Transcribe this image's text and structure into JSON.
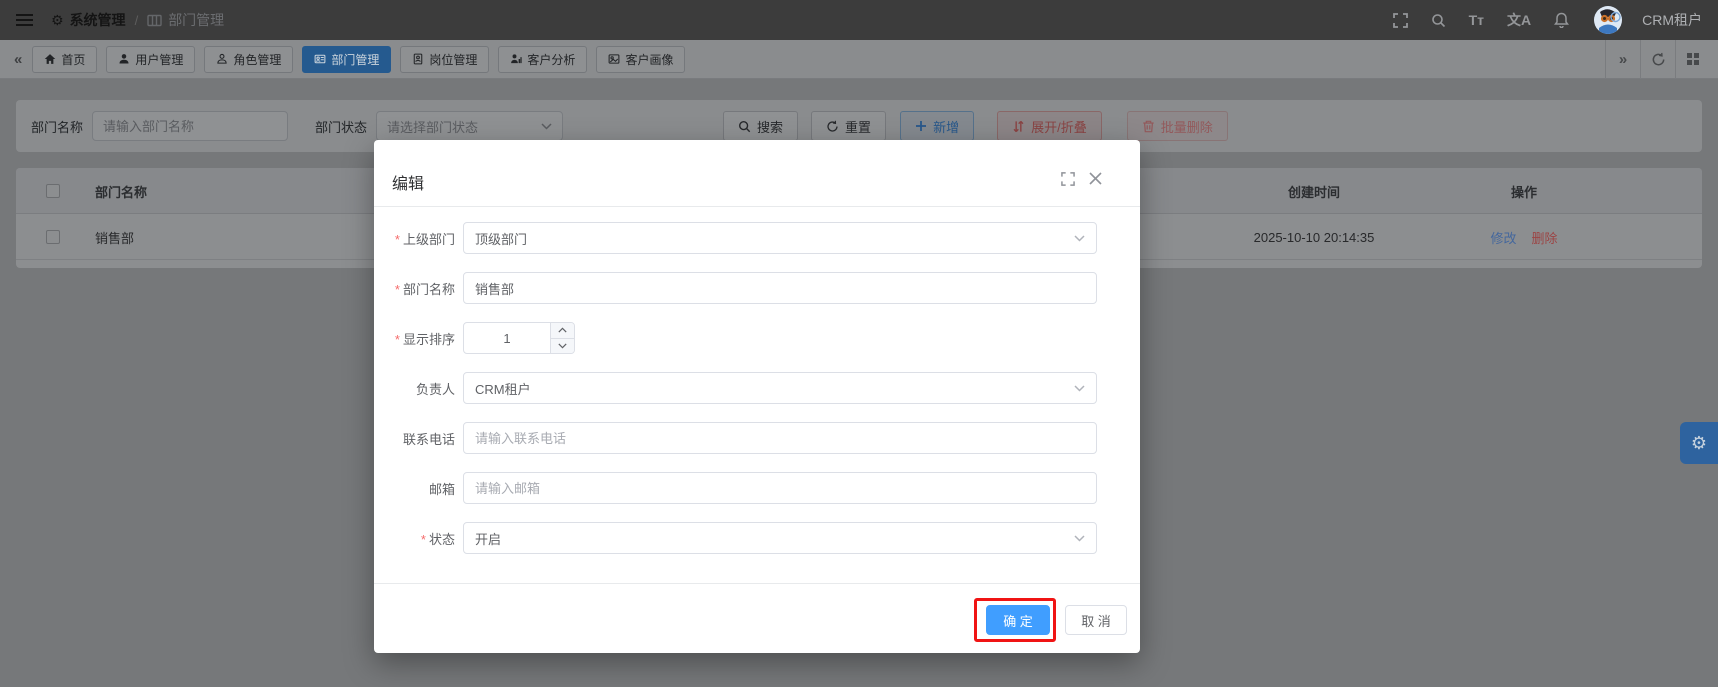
{
  "header": {
    "breadcrumb": {
      "section": "系统管理",
      "separator": "/",
      "page": "部门管理"
    },
    "tenant": "CRM租户",
    "icon_glyphs": {
      "gear": "⚙",
      "font_size": "Tт",
      "translate": "文A"
    }
  },
  "tabs": {
    "collapse_left": "«",
    "expand_right": "»",
    "items": [
      "首页",
      "用户管理",
      "角色管理",
      "部门管理",
      "岗位管理",
      "客户分析",
      "客户画像"
    ],
    "active_index": 3
  },
  "filter": {
    "name_label": "部门名称",
    "name_placeholder": "请输入部门名称",
    "status_label": "部门状态",
    "status_placeholder": "请选择部门状态",
    "buttons": {
      "search": "搜索",
      "reset": "重置",
      "add": "新增",
      "toggle": "展开/折叠",
      "batch_delete": "批量删除"
    }
  },
  "table": {
    "columns": {
      "name": "部门名称",
      "created": "创建时间",
      "actions": "操作"
    },
    "rows": [
      {
        "name": "销售部",
        "created": "2025-10-10 20:14:35",
        "edit": "修改",
        "delete": "删除"
      }
    ]
  },
  "dialog": {
    "title": "编辑",
    "fields": [
      {
        "label": "上级部门",
        "required": true,
        "type": "select",
        "value": "顶级部门"
      },
      {
        "label": "部门名称",
        "required": true,
        "type": "input",
        "value": "销售部"
      },
      {
        "label": "显示排序",
        "required": true,
        "type": "number",
        "value": "1"
      },
      {
        "label": "负责人",
        "required": false,
        "type": "select",
        "value": "CRM租户"
      },
      {
        "label": "联系电话",
        "required": false,
        "type": "input",
        "placeholder": "请输入联系电话"
      },
      {
        "label": "邮箱",
        "required": false,
        "type": "input",
        "placeholder": "请输入邮箱"
      },
      {
        "label": "状态",
        "required": true,
        "type": "select",
        "value": "开启"
      }
    ],
    "confirm": "确 定",
    "cancel": "取 消"
  },
  "colors": {
    "accent_blue": "#409eff",
    "required_red": "#f56c6c",
    "highlight_box_red": "#f01414",
    "active_tab_blue_dimmed": "#255a8f",
    "topbar_dimmed": "#3c3c3c"
  }
}
